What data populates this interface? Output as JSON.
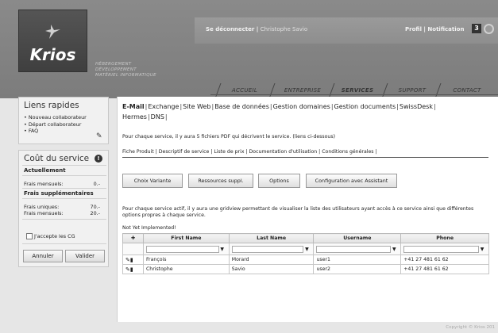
{
  "brand": {
    "name": "Krios",
    "tagline": [
      "HÉBERGEMENT",
      "DÉVELOPPEMENT",
      "MATÉRIEL INFORMATIQUE"
    ]
  },
  "topbar": {
    "logout_label": "Se déconnecter",
    "user_name": "Christophe Savio",
    "profil_label": "Profil",
    "notification_label": "Notification",
    "notification_count": "3"
  },
  "nav": [
    "ACCUEIL",
    "ENTREPRISE",
    "SERVICES",
    "SUPPORT",
    "CONTACT"
  ],
  "quicklinks": {
    "title": "Liens rapides",
    "items": [
      "Nouveau collaborateur",
      "Départ collaborateur",
      "FAQ"
    ]
  },
  "cost": {
    "title": "Coût du service",
    "current_label": "Actuellement",
    "monthly_label": "Frais mensuels:",
    "monthly_value": "0.-",
    "extra_label": "Frais supplémentaires",
    "unique_label": "Frais uniques:",
    "unique_value": "70.-",
    "extra_monthly_label": "Frais mensuels:",
    "extra_monthly_value": "20.-",
    "accept_label": "J'accepte les CG",
    "cancel_label": "Annuler",
    "validate_label": "Valider"
  },
  "main": {
    "tabs": [
      "E-Mail",
      "Exchange",
      "Site Web",
      "Base de données",
      "Gestion domaines",
      "Gestion documents",
      "SwissDesk",
      "Hermes",
      "DNS"
    ],
    "intro": "Pour chaque service, il y aura 5 fichiers PDF qui décrivent le service. (liens ci-dessous)",
    "doc_tabs": [
      "Fiche Produit",
      "Descriptif de service",
      "Liste de prix",
      "Documentation d'utilisation",
      "Conditions générales"
    ],
    "actions": [
      "Choix Variante",
      "Ressources suppl.",
      "Options",
      "Configuration avec Assistant"
    ],
    "description": "Pour chaque service actif, il y aura une gridview permettant de visualiser la liste des utilisateurs ayant accès à ce service ainsi que différentes options propres à chaque service.",
    "not_implemented": "Not Yet Implemented!",
    "grid": {
      "columns": [
        "First Name",
        "Last Name",
        "Username",
        "Phone"
      ],
      "rows": [
        {
          "first": "François",
          "last": "Morard",
          "username": "user1",
          "phone": "+41 27 481 61 62"
        },
        {
          "first": "Christophe",
          "last": "Savio",
          "username": "user2",
          "phone": "+41 27 481 61 62"
        }
      ]
    }
  },
  "footer": "Copyright © Krios 201"
}
